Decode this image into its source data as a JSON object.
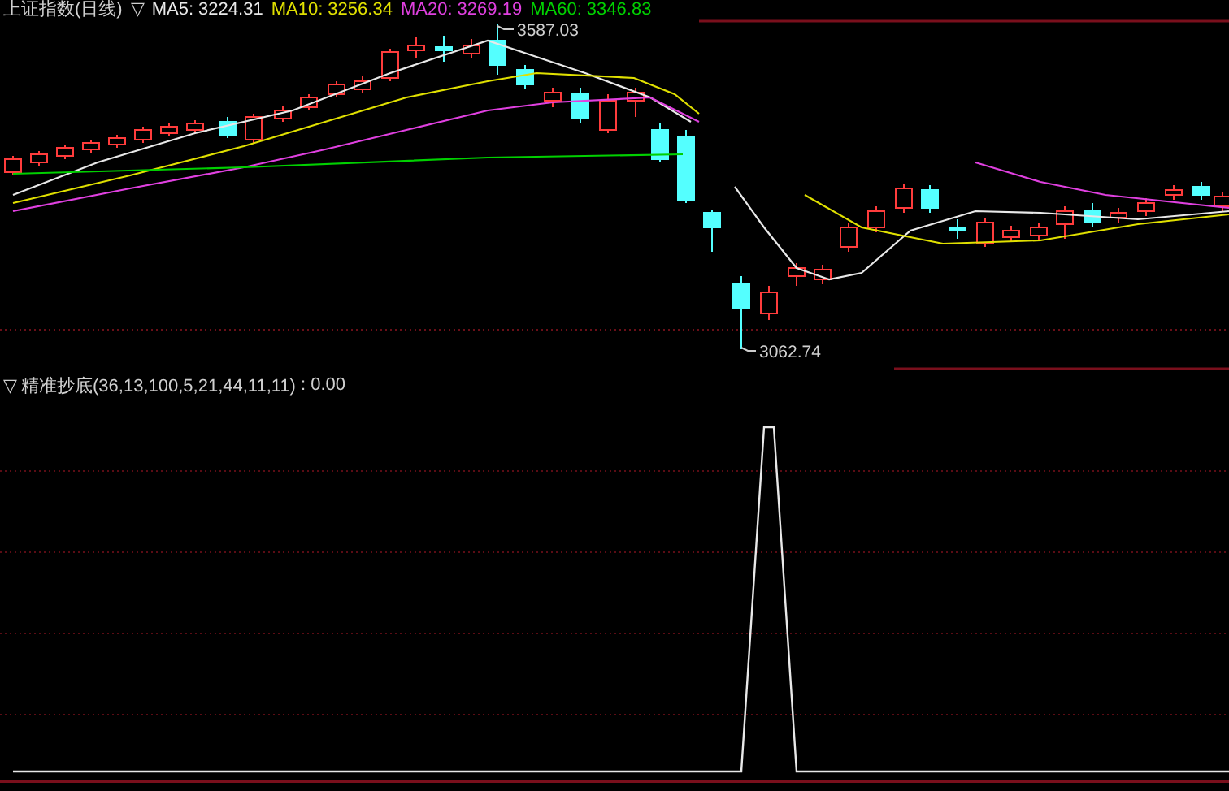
{
  "legend": {
    "marker": "▽",
    "title": "上证指数(日线)",
    "averages": [
      {
        "label": "MA5:",
        "value": "3224.31",
        "color": "#e8e8e8"
      },
      {
        "label": "MA10:",
        "value": "3256.34",
        "color": "#e0e000"
      },
      {
        "label": "MA20:",
        "value": "3269.19",
        "color": "#e040e0"
      },
      {
        "label": "MA60:",
        "value": "3346.83",
        "color": "#00d000"
      }
    ]
  },
  "price_chart": {
    "high_label": "3587.03",
    "low_label": "3062.74"
  },
  "indicator": {
    "marker": "▽",
    "name": "精准抄底(36,13,100,5,21,44,11,11)",
    "value": ": 0.00"
  }
}
